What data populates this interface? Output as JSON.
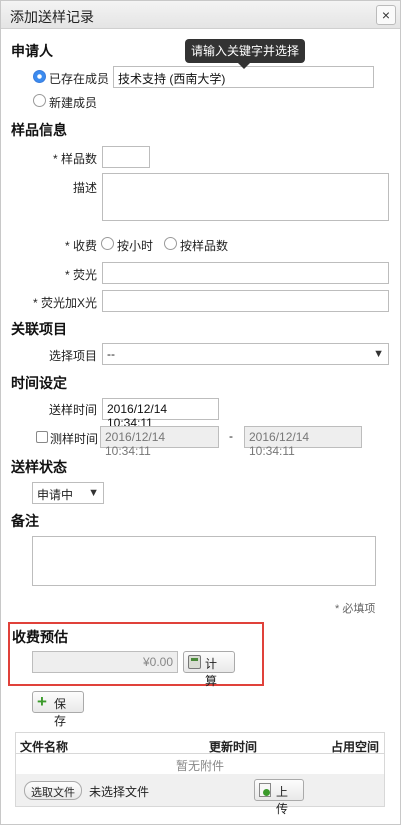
{
  "dialog": {
    "title": "添加送样记录",
    "close": "×"
  },
  "applicant": {
    "section": "申请人",
    "existing_label": "已存在成员",
    "existing_value": "技术支持 (西南大学)",
    "new_label": "新建成员",
    "tooltip": "请输入关键字并选择"
  },
  "sample": {
    "section": "样品信息",
    "count_label": "* 样品数",
    "count_value": "",
    "desc_label": "描述",
    "fee_label": "* 收费",
    "fee_opt_hour": "按小时",
    "fee_opt_count": "按样品数",
    "fluor_label": "* 荧光",
    "fluor_value": "",
    "fluor_xray_label": "* 荧光加X光",
    "fluor_xray_value": ""
  },
  "project": {
    "section": "关联项目",
    "select_label": "选择项目",
    "select_value": "--"
  },
  "time": {
    "section": "时间设定",
    "send_label": "送样时间",
    "send_value": "2016/12/14 10:34:11",
    "test_label": "测样时间",
    "test_start": "2016/12/14 10:34:11",
    "dash": "-",
    "test_end": "2016/12/14 10:34:11"
  },
  "status": {
    "section": "送样状态",
    "value": "申请中"
  },
  "notes": {
    "section": "备注",
    "required_hint": "* 必填项"
  },
  "estimate": {
    "section": "收费预估",
    "amount": "¥0.00",
    "calc_label": "计算"
  },
  "save_label": "保存",
  "files": {
    "col_name": "文件名称",
    "col_updated": "更新时间",
    "col_space": "占用空间",
    "empty": "暂无附件",
    "choose_label": "选取文件",
    "no_file": "未选择文件",
    "upload_label": "上传"
  }
}
